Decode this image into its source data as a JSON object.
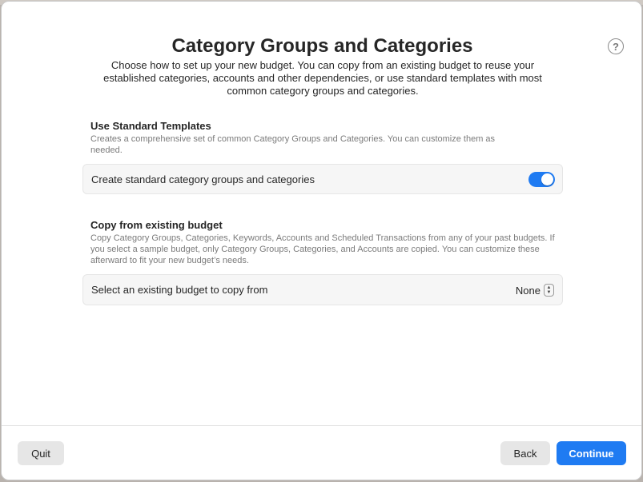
{
  "dialog": {
    "title": "Category Groups and Categories",
    "subtitle": "Choose how to set up your new budget. You can copy from an existing budget to reuse your established categories, accounts and other dependencies, or use standard templates with most common category groups and categories.",
    "help_glyph": "?"
  },
  "standard_templates": {
    "heading": "Use Standard Templates",
    "description": "Creates a comprehensive set of common Category Groups and Categories. You can customize them as needed.",
    "toggle_label": "Create standard category groups and categories",
    "toggle_on": true
  },
  "copy_budget": {
    "heading": "Copy from existing budget",
    "description": "Copy Category Groups, Categories, Keywords, Accounts and Scheduled Transactions from any of your past budgets. If you select a sample budget, only Category Groups, Categories, and Accounts are copied. You can customize these afterward to fit your new budget’s needs.",
    "select_label": "Select an existing budget to copy from",
    "select_value": "None"
  },
  "footer": {
    "quit_label": "Quit",
    "back_label": "Back",
    "continue_label": "Continue"
  },
  "colors": {
    "accent": "#1f7bf2"
  }
}
